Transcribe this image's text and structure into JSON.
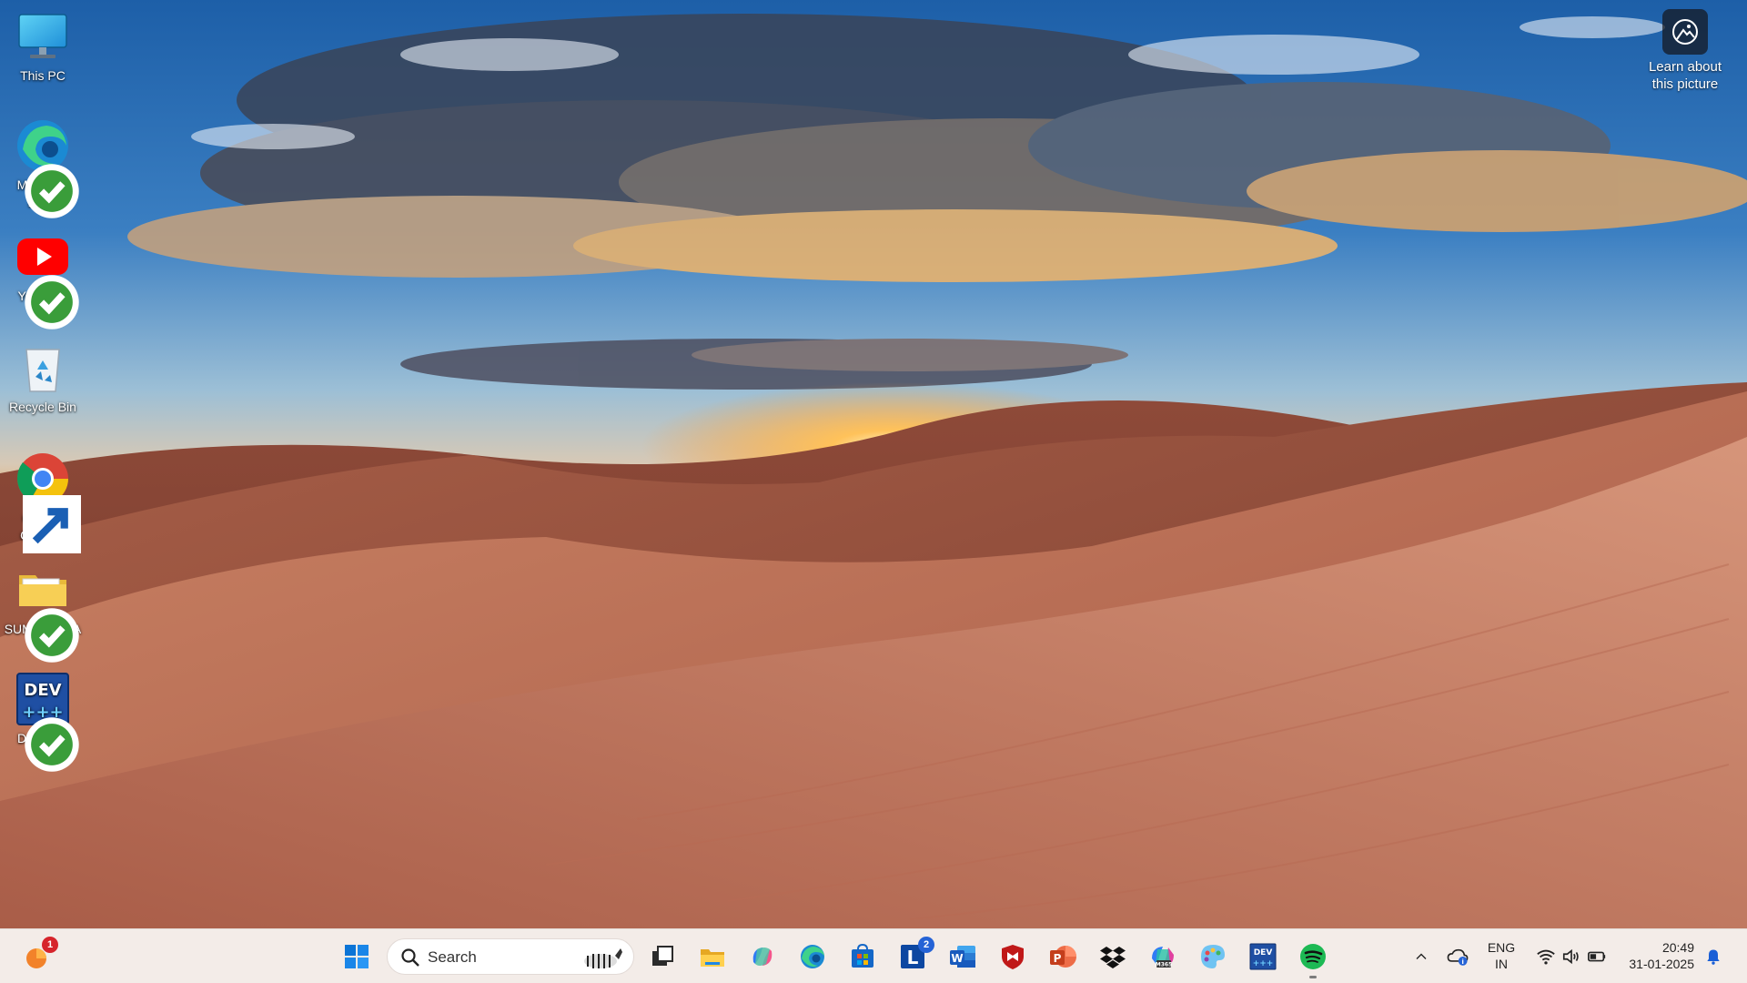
{
  "desktop": {
    "icons": [
      {
        "label": "This PC",
        "icon": "monitor-icon"
      },
      {
        "label": "Microsoft Edge",
        "icon": "edge-icon"
      },
      {
        "label": "YouTube",
        "icon": "youtube-icon"
      },
      {
        "label": "Recycle Bin",
        "icon": "recycle-bin-icon"
      },
      {
        "label": "Google Chrome",
        "icon": "chrome-icon"
      },
      {
        "label": "SUMALATHA",
        "icon": "folder-icon"
      },
      {
        "label": "Dev-C++",
        "icon": "devcpp-icon"
      }
    ],
    "learn_about": "Learn about this picture"
  },
  "taskbar": {
    "widget_badge": "1",
    "search_placeholder": "Search",
    "apps": [
      {
        "name": "Start",
        "icon": "windows-start-icon"
      },
      {
        "name": "Task View",
        "icon": "task-view-icon"
      },
      {
        "name": "File Explorer",
        "icon": "file-explorer-icon"
      },
      {
        "name": "Copilot",
        "icon": "copilot-icon"
      },
      {
        "name": "Microsoft Edge",
        "icon": "edge-icon"
      },
      {
        "name": "Microsoft Store",
        "icon": "store-icon"
      },
      {
        "name": "L app",
        "icon": "l-app-icon",
        "badge": "2"
      },
      {
        "name": "Word",
        "icon": "word-icon"
      },
      {
        "name": "McAfee",
        "icon": "mcafee-icon"
      },
      {
        "name": "PowerPoint",
        "icon": "powerpoint-icon"
      },
      {
        "name": "Dropbox",
        "icon": "dropbox-icon"
      },
      {
        "name": "Microsoft 365",
        "icon": "m365-icon"
      },
      {
        "name": "Paint",
        "icon": "paint-icon"
      },
      {
        "name": "Dev-C++",
        "icon": "devcpp-icon"
      },
      {
        "name": "Spotify",
        "icon": "spotify-icon"
      }
    ],
    "tray": {
      "lang_top": "ENG",
      "lang_bottom": "IN",
      "time": "20:49",
      "date": "31-01-2025"
    }
  },
  "colors": {
    "taskbar_bg": "#f3ece8",
    "accent_blue": "#0078d4"
  }
}
